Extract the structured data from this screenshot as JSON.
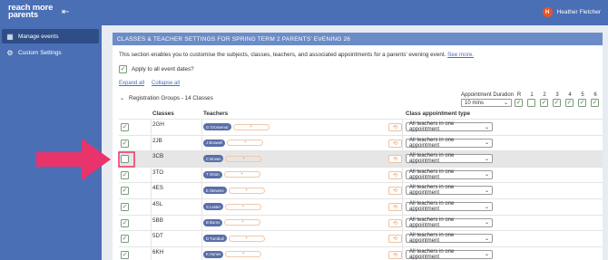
{
  "header": {
    "logo_line1": "reach more",
    "logo_line2": "parents",
    "user_name": "Heather Fletcher",
    "user_initial": "H"
  },
  "sidebar": {
    "items": [
      {
        "label": "Manage events",
        "icon": "calendar-icon",
        "active": true
      },
      {
        "label": "Custom Settings",
        "icon": "gear-icon",
        "active": false
      }
    ]
  },
  "panel": {
    "title": "CLASSES & TEACHER SETTINGS FOR SPRING TERM 2 PARENTS' EVENING 26",
    "description": "This section enables you to customise the subjects, classes, teachers, and associated appointments for a parents' evening event.",
    "see_more": "See more.",
    "apply_all_label": "Apply to all event dates?",
    "expand_all": "Expand all",
    "collapse_all": "Collapse all",
    "groups_label": "Registration Groups - 14 Classes",
    "duration_label": "Appointment Duration",
    "duration_value": "10 mins",
    "year_labels": [
      "R",
      "1",
      "2",
      "3",
      "4",
      "5",
      "6"
    ],
    "year_checked": [
      true,
      false,
      true,
      true,
      true,
      true,
      true
    ],
    "columns": {
      "classes": "Classes",
      "teachers": "Teachers",
      "appt_type": "Class appointment type"
    },
    "rows": [
      {
        "class": "2GH",
        "teacher": "G Grosvenor",
        "appt": "All teachers in one appointment",
        "checked": true
      },
      {
        "class": "2JB",
        "teacher": "J Boswell",
        "appt": "All teachers in one appointment",
        "checked": true
      },
      {
        "class": "3CB",
        "teacher": "C Brown",
        "appt": "All teachers in one appointment",
        "checked": false
      },
      {
        "class": "3TO",
        "teacher": "T Orton",
        "appt": "All teachers in one appointment",
        "checked": true
      },
      {
        "class": "4ES",
        "teacher": "E Stevens",
        "appt": "All teachers in one appointment",
        "checked": true
      },
      {
        "class": "4SL",
        "teacher": "S Lester",
        "appt": "All teachers in one appointment",
        "checked": true
      },
      {
        "class": "5BB",
        "teacher": "B Burns",
        "appt": "All teachers in one appointment",
        "checked": true
      },
      {
        "class": "5DT",
        "teacher": "D Turnbull",
        "appt": "All teachers in one appointment",
        "checked": true
      },
      {
        "class": "6KH",
        "teacher": "K Hynes",
        "appt": "All teachers in one appointment",
        "checked": true
      }
    ]
  },
  "colors": {
    "brand": "#4a6fb5",
    "highlight_arrow": "#e8336b",
    "avatar": "#e8542a"
  }
}
